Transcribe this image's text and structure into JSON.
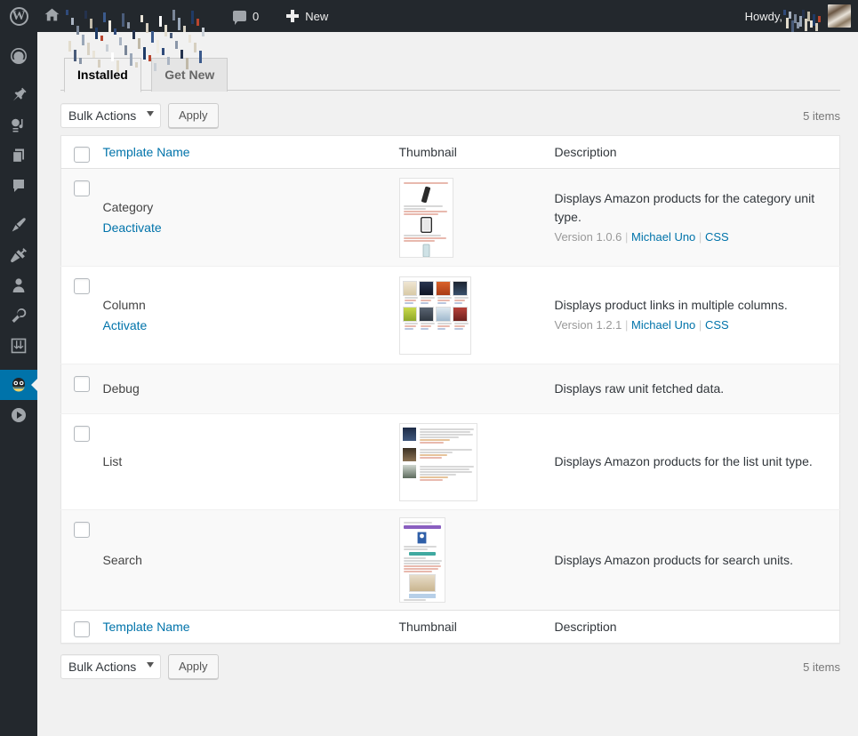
{
  "adminbar": {
    "wp_logo": "wordpress-logo",
    "home_icon": "home-icon",
    "site_title_redacted": "",
    "comments_count": "0",
    "new_label": "New",
    "howdy_label": "Howdy,",
    "user_name_redacted": ""
  },
  "sidebar": {
    "items": [
      {
        "icon": "dashboard-icon",
        "name": "dashboard",
        "current": false
      },
      {
        "icon": "pin-posts-icon",
        "name": "posts",
        "current": false
      },
      {
        "icon": "media-icon",
        "name": "media",
        "current": false
      },
      {
        "icon": "pages-icon",
        "name": "pages",
        "current": false
      },
      {
        "icon": "comments-icon",
        "name": "comments",
        "current": false
      },
      {
        "icon": "appearance-brush-icon",
        "name": "appearance",
        "current": false
      },
      {
        "icon": "plugins-plug-icon",
        "name": "plugins",
        "current": false
      },
      {
        "icon": "users-icon",
        "name": "users",
        "current": false
      },
      {
        "icon": "tools-wrench-icon",
        "name": "tools",
        "current": false
      },
      {
        "icon": "settings-sliders-icon",
        "name": "settings",
        "current": false
      },
      {
        "icon": "amazon-auto-links-icon",
        "name": "amazon-auto-links",
        "current": true
      },
      {
        "icon": "play-circle-icon",
        "name": "media-player",
        "current": false
      }
    ]
  },
  "tabs": [
    {
      "label": "Installed",
      "active": true
    },
    {
      "label": "Get New",
      "active": false
    }
  ],
  "tablenav": {
    "bulk_actions_label": "Bulk Actions",
    "apply_label": "Apply",
    "displaying_num": "5 items"
  },
  "table": {
    "columns": {
      "name": "Template Name",
      "thumbnail": "Thumbnail",
      "description": "Description"
    },
    "rows": [
      {
        "name": "Category",
        "action": "Deactivate",
        "description": "Displays Amazon products for the category unit type.",
        "version": "Version 1.0.6",
        "author": "Michael Uno",
        "css": "CSS",
        "thumbnail": "category-template-preview"
      },
      {
        "name": "Column",
        "action": "Activate",
        "description": "Displays product links in multiple columns.",
        "version": "Version 1.2.1",
        "author": "Michael Uno",
        "css": "CSS",
        "thumbnail": "column-template-preview"
      },
      {
        "name": "Debug",
        "action": "",
        "description": "Displays raw unit fetched data.",
        "version": "",
        "author": "",
        "css": "",
        "thumbnail": ""
      },
      {
        "name": "List",
        "action": "",
        "description": "Displays Amazon products for the list unit type.",
        "version": "",
        "author": "",
        "css": "",
        "thumbnail": "list-template-preview"
      },
      {
        "name": "Search",
        "action": "",
        "description": "Displays Amazon products for search units.",
        "version": "",
        "author": "",
        "css": "",
        "thumbnail": "search-template-preview"
      }
    ]
  },
  "colors": {
    "admin_bar_bg": "#23282d",
    "current_menu_bg": "#0073aa",
    "link": "#0073aa",
    "page_bg": "#f1f1f1",
    "row_alt_bg": "#f9f9f9"
  }
}
